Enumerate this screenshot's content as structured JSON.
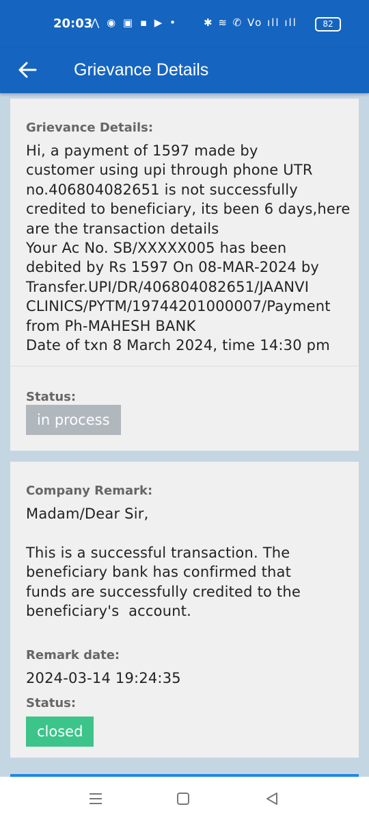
{
  "status_bar": {
    "time": "20:03",
    "left_icons": "⋀ ◉ ▣ ▪ ▶ •",
    "right_icons": "✱ ≋ ✆ Vo ıll ıll",
    "battery": "82"
  },
  "app_bar": {
    "title": "Grievance Details",
    "back_icon": "arrow-left-icon"
  },
  "grievance": {
    "label": "Grievance Details:",
    "text": "Hi, a payment of 1597 made by\ncustomer using upi through phone UTR\nno.406804082651 is not successfully\ncredited to beneficiary, its been 6 days,here\nare the transaction details\nYour Ac No. SB/XXXXX005 has been\ndebited by Rs 1597 On 08-MAR-2024 by\nTransfer.UPI/DR/406804082651/JAANVI\nCLINICS/PYTM/19744201000007/Payment\nfrom Ph-MAHESH BANK\nDate of txn 8 March 2024, time 14:30 pm",
    "status_label": "Status:",
    "status_value": "in process"
  },
  "remark": {
    "label": "Company Remark:",
    "text": "Madam/Dear Sir,\n\nThis is a successful transaction. The\nbeneficiary bank has confirmed that\nfunds are successfully credited to the\nbeneficiary's  account.",
    "date_label": "Remark date:",
    "date_value": "2024-03-14 19:24:35",
    "status_label": "Status:",
    "status_value": "closed"
  },
  "nav": {
    "recents_icon": "menu-icon",
    "home_icon": "square-icon",
    "back_icon": "triangle-back-icon"
  },
  "colors": {
    "primary": "#1565c0",
    "background": "#c5d6e3",
    "card": "#f0f0f0",
    "status_in_process": "#b0b7bd",
    "status_closed": "#3cc48a"
  }
}
